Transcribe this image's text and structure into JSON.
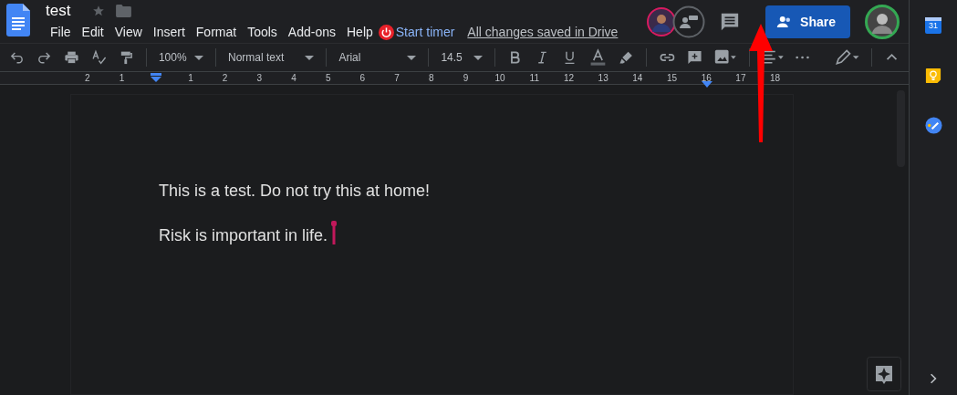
{
  "document": {
    "title": "test",
    "starred": false
  },
  "menu": [
    "File",
    "Edit",
    "View",
    "Insert",
    "Format",
    "Tools",
    "Add-ons",
    "Help"
  ],
  "timer": "Start timer",
  "save_status": "All changes saved in Drive",
  "share": "Share",
  "toolbar": {
    "zoom": "100%",
    "style": "Normal text",
    "font": "Arial",
    "size": "14.5"
  },
  "ruler": {
    "before": [
      "2",
      "1"
    ],
    "after": [
      "1",
      "2",
      "3",
      "4",
      "5",
      "6",
      "7",
      "8",
      "9",
      "10",
      "11",
      "12",
      "13",
      "14",
      "15",
      "16",
      "17",
      "18"
    ]
  },
  "paragraphs": [
    "This is a test. Do not try this at home!",
    "Risk is important in life."
  ],
  "calendar_day": "31"
}
